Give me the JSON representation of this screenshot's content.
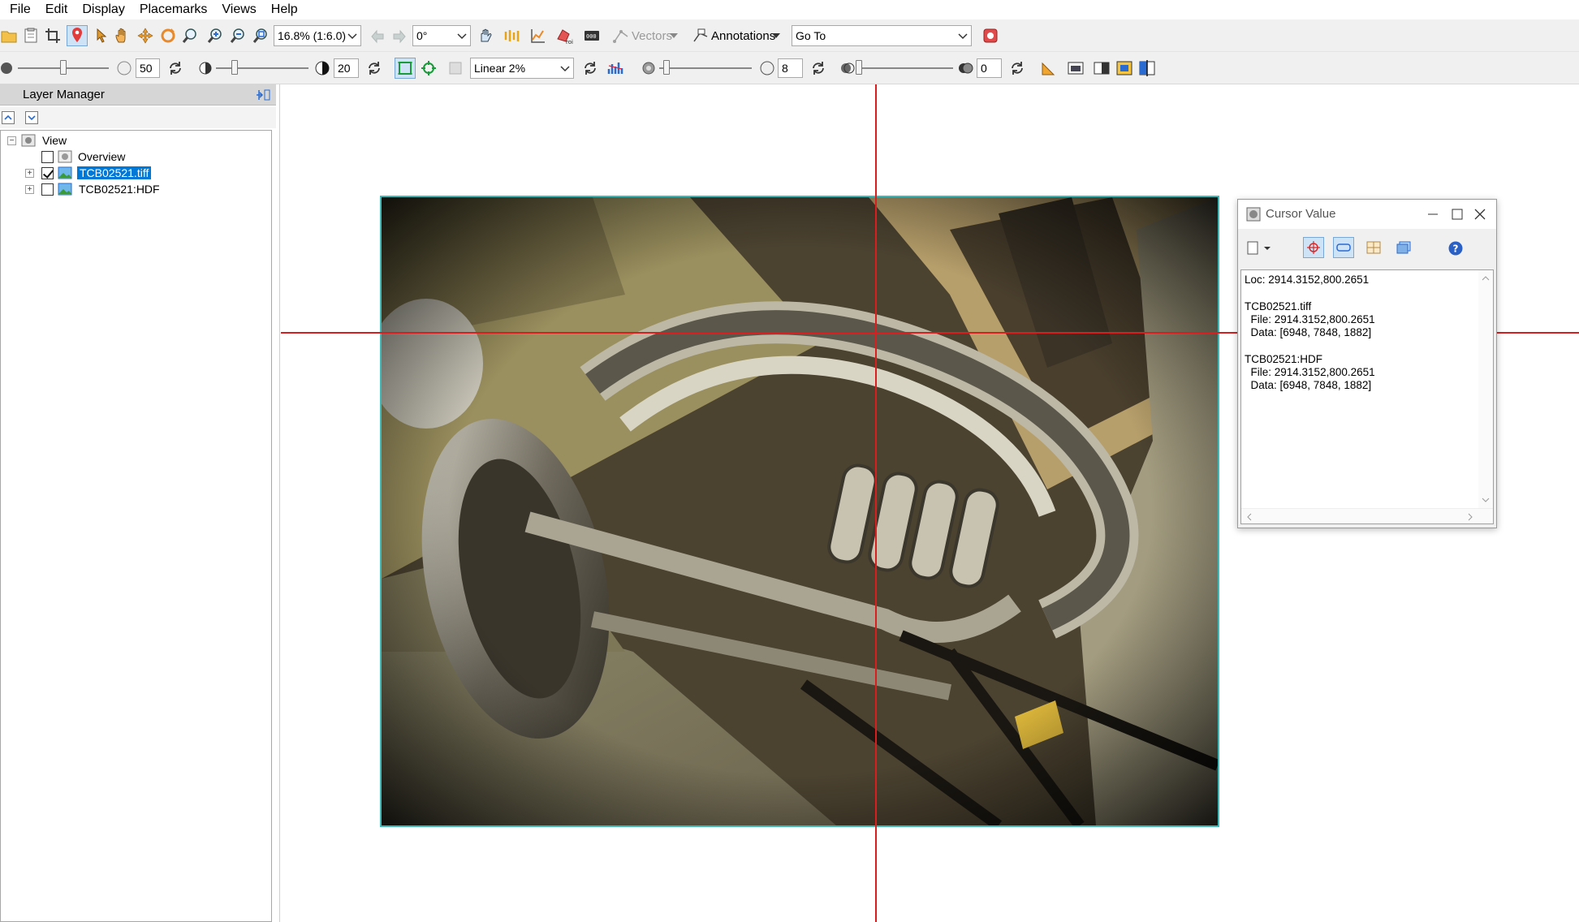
{
  "menu": {
    "file": "File",
    "edit": "Edit",
    "display": "Display",
    "placemarks": "Placemarks",
    "views": "Views",
    "help": "Help"
  },
  "toolbar1": {
    "zoom_value": "16.8% (1:6.0)",
    "rotation_value": "0°",
    "vectors_label": "Vectors",
    "annotations_label": "Annotations",
    "goto_value": "Go To"
  },
  "toolbar2": {
    "brightness_value": "50",
    "contrast_value": "20",
    "stretch_value": "Linear 2%",
    "sharpen_value": "8",
    "transparency_value": "0",
    "brightness_level": 0.5,
    "contrast_level": 0.2,
    "sharpen_level": 0.08,
    "transparency_level": 0.0
  },
  "layer_manager": {
    "title": "Layer Manager",
    "tree": {
      "view": "View",
      "overview": "Overview",
      "layer1": "TCB02521.tiff",
      "layer2": "TCB02521:HDF"
    },
    "layer1_checked": true,
    "layer2_checked": false,
    "overview_checked": false
  },
  "cursor_value": {
    "title": "Cursor Value",
    "content": "Loc: 2914.3152,800.2651\n\nTCB02521.tiff\n  File: 2914.3152,800.2651\n  Data: [6948, 7848, 1882]\n\nTCB02521:HDF\n  File: 2914.3152,800.2651\n  Data: [6948, 7848, 1882]"
  },
  "icons": {
    "open": "open-folder-icon",
    "data_manager": "data-manager-icon",
    "crop": "crop-icon",
    "cursor_value": "cursor-value-icon",
    "select": "select-arrow-icon",
    "pan": "pan-hand-icon",
    "fly": "fly-icon",
    "rotate": "rotate-icon",
    "zoom": "zoom-icon",
    "zoom_in": "zoom-in-icon",
    "zoom_out": "zoom-out-icon",
    "zoom_full": "zoom-full-icon"
  },
  "colors": {
    "crosshair": "#d81e1e",
    "raster_border": "#3fb8b8",
    "selection": "#0078d7"
  }
}
